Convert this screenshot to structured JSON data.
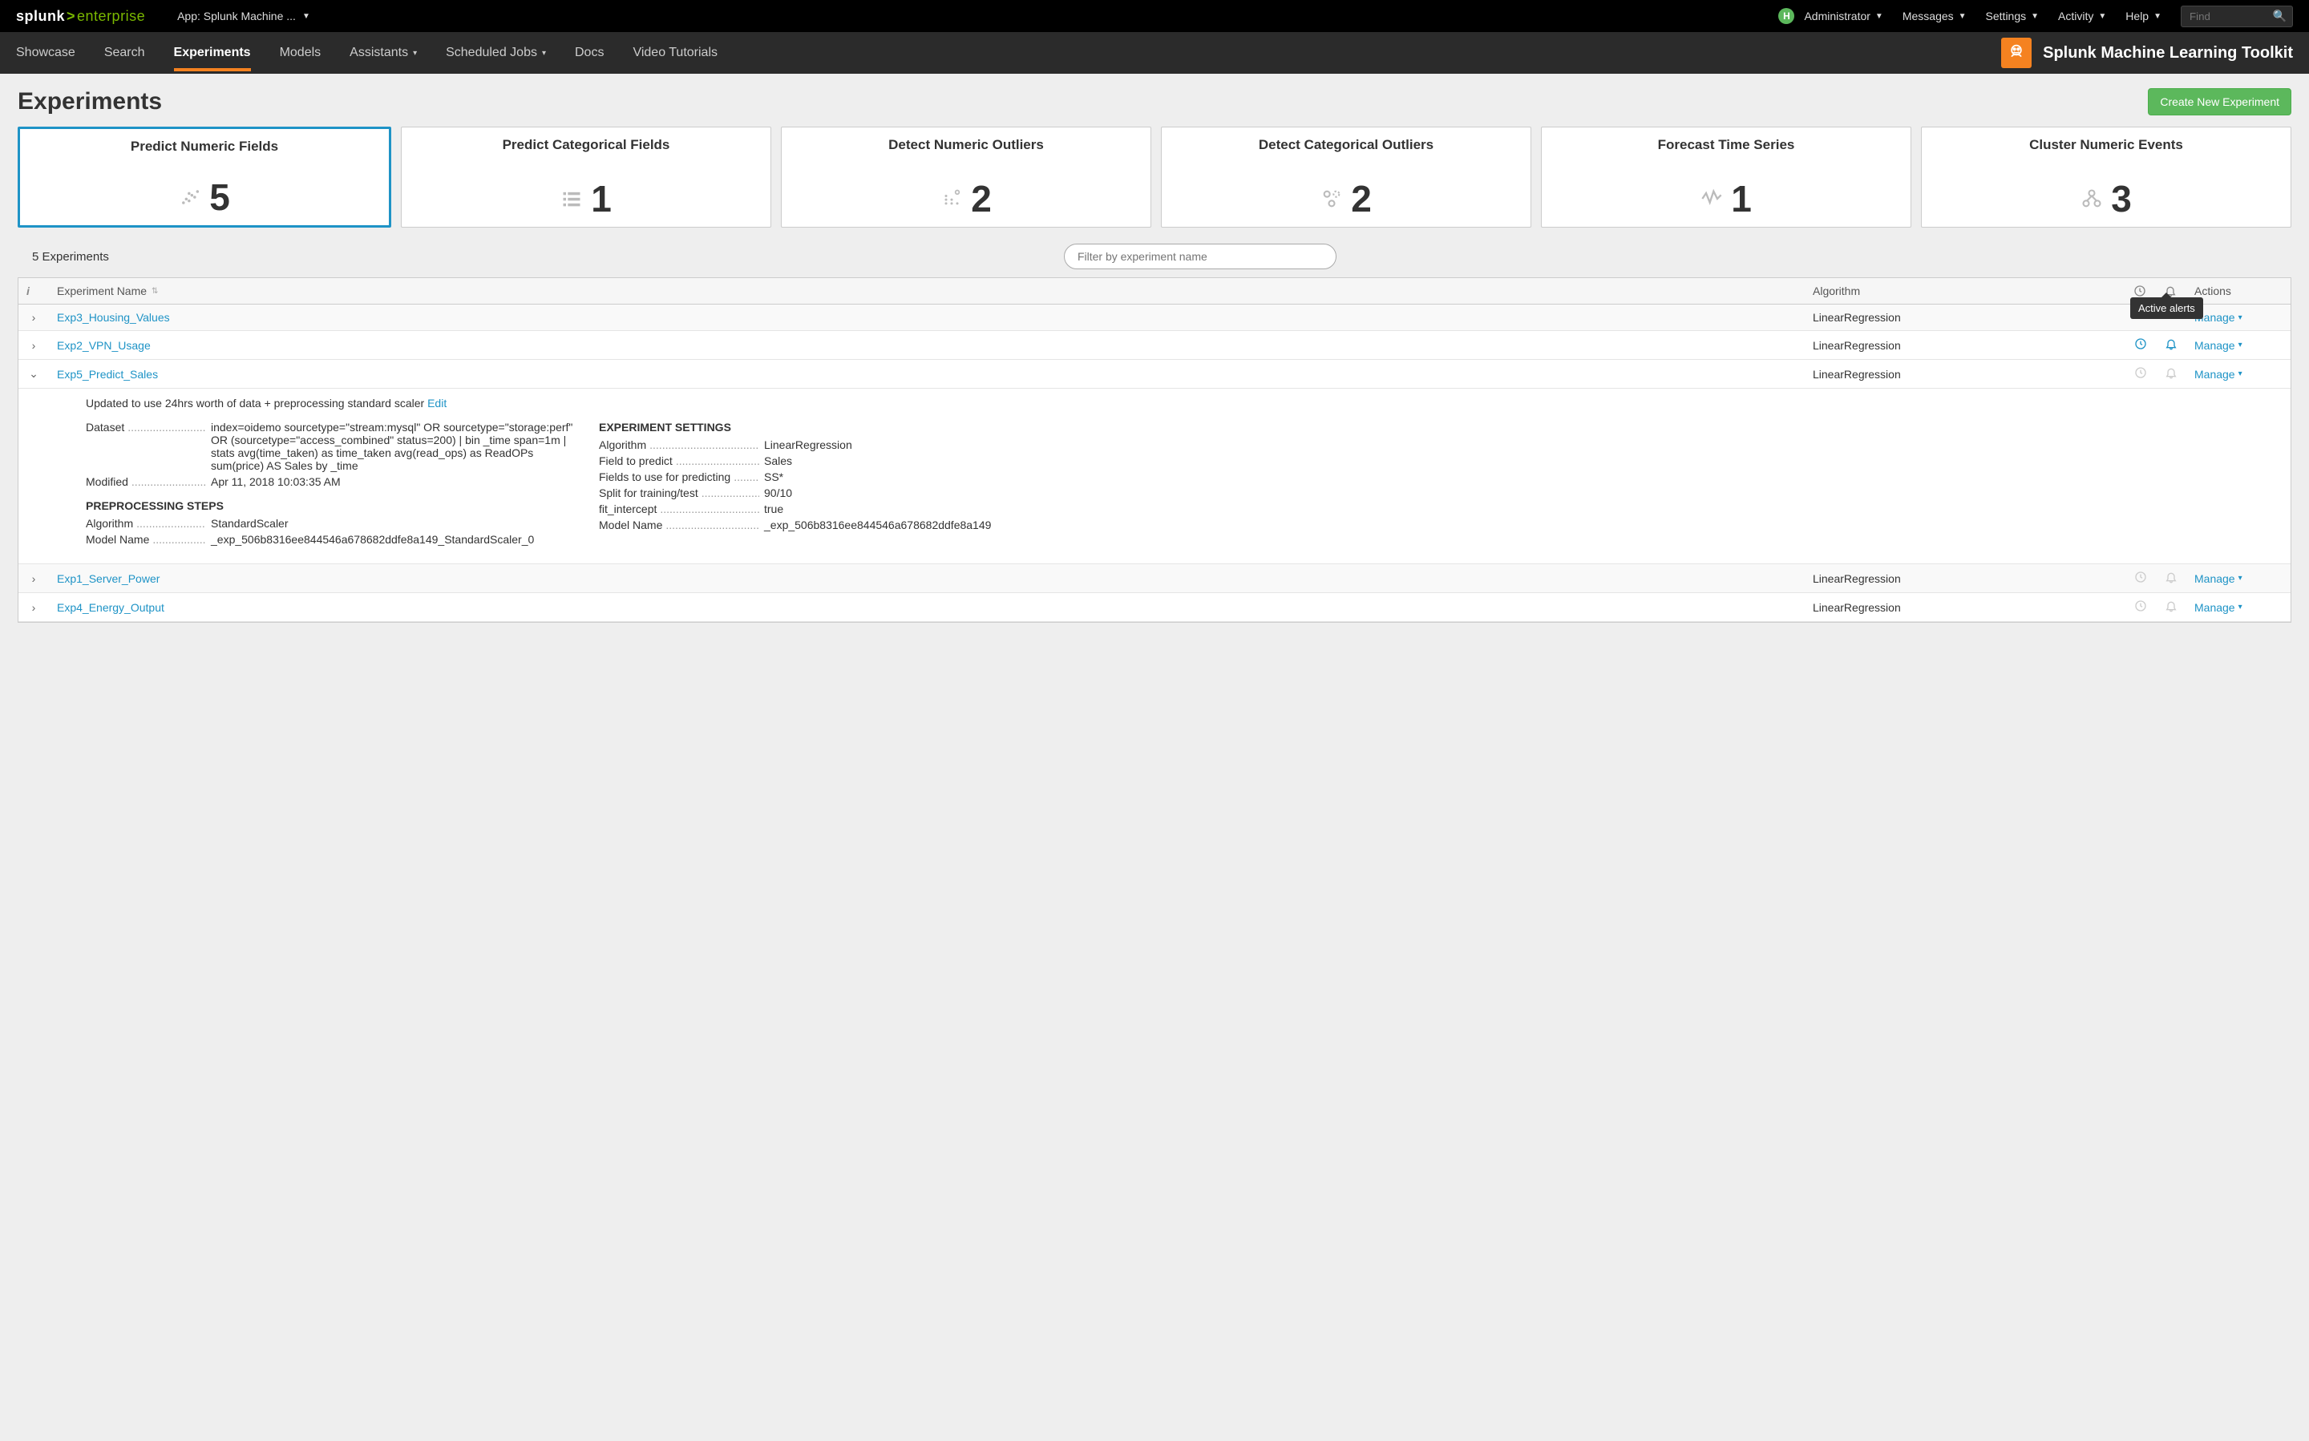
{
  "topbar": {
    "logo_prefix": "splunk",
    "logo_suffix": "enterprise",
    "app_selector": "App: Splunk Machine ...",
    "avatar_letter": "H",
    "items": [
      "Administrator",
      "Messages",
      "Settings",
      "Activity",
      "Help"
    ],
    "find_placeholder": "Find"
  },
  "nav": {
    "items": [
      {
        "label": "Showcase",
        "active": false,
        "dropdown": false
      },
      {
        "label": "Search",
        "active": false,
        "dropdown": false
      },
      {
        "label": "Experiments",
        "active": true,
        "dropdown": false
      },
      {
        "label": "Models",
        "active": false,
        "dropdown": false
      },
      {
        "label": "Assistants",
        "active": false,
        "dropdown": true
      },
      {
        "label": "Scheduled Jobs",
        "active": false,
        "dropdown": true
      },
      {
        "label": "Docs",
        "active": false,
        "dropdown": false
      },
      {
        "label": "Video Tutorials",
        "active": false,
        "dropdown": false
      }
    ],
    "app_title": "Splunk Machine Learning Toolkit"
  },
  "page": {
    "title": "Experiments",
    "create_btn": "Create New Experiment",
    "cards": [
      {
        "title": "Predict Numeric Fields",
        "count": "5",
        "selected": true
      },
      {
        "title": "Predict Categorical Fields",
        "count": "1",
        "selected": false
      },
      {
        "title": "Detect Numeric Outliers",
        "count": "2",
        "selected": false
      },
      {
        "title": "Detect Categorical Outliers",
        "count": "2",
        "selected": false
      },
      {
        "title": "Forecast Time Series",
        "count": "1",
        "selected": false
      },
      {
        "title": "Cluster Numeric Events",
        "count": "3",
        "selected": false
      }
    ],
    "experiments_count_label": "5 Experiments",
    "filter_placeholder": "Filter by experiment name",
    "tooltip_active_alerts": "Active alerts"
  },
  "table": {
    "headers": {
      "name": "Experiment Name",
      "algo": "Algorithm",
      "actions": "Actions"
    },
    "rows": [
      {
        "name": "Exp3_Housing_Values",
        "algo": "LinearRegression",
        "sched": false,
        "alert": false,
        "expanded": false,
        "manage": "Manage"
      },
      {
        "name": "Exp2_VPN_Usage",
        "algo": "LinearRegression",
        "sched": true,
        "alert": true,
        "expanded": false,
        "manage": "Manage"
      },
      {
        "name": "Exp5_Predict_Sales",
        "algo": "LinearRegression",
        "sched": false,
        "alert": false,
        "expanded": true,
        "manage": "Manage"
      },
      {
        "name": "Exp1_Server_Power",
        "algo": "LinearRegression",
        "sched": false,
        "alert": false,
        "expanded": false,
        "manage": "Manage"
      },
      {
        "name": "Exp4_Energy_Output",
        "algo": "LinearRegression",
        "sched": false,
        "alert": false,
        "expanded": false,
        "manage": "Manage"
      }
    ]
  },
  "details": {
    "description": "Updated to use 24hrs worth of data + preprocessing standard scaler",
    "edit_label": "Edit",
    "dataset_label": "Dataset",
    "dataset_value": "index=oidemo sourcetype=\"stream:mysql\" OR sourcetype=\"storage:perf\" OR (sourcetype=\"access_combined\" status=200) | bin _time span=1m | stats avg(time_taken) as time_taken avg(read_ops) as ReadOPs sum(price) AS Sales by _time",
    "modified_label": "Modified",
    "modified_value": "Apr 11, 2018 10:03:35 AM",
    "preproc_hdr": "PREPROCESSING STEPS",
    "preproc_algo_label": "Algorithm",
    "preproc_algo_value": "StandardScaler",
    "preproc_model_label": "Model Name",
    "preproc_model_value": "_exp_506b8316ee844546a678682ddfe8a149_StandardScaler_0",
    "settings_hdr": "EXPERIMENT SETTINGS",
    "settings": [
      {
        "label": "Algorithm",
        "value": "LinearRegression"
      },
      {
        "label": "Field to predict",
        "value": "Sales"
      },
      {
        "label": "Fields to use for predicting",
        "value": "SS*"
      },
      {
        "label": "Split for training/test",
        "value": "90/10"
      },
      {
        "label": "fit_intercept",
        "value": "true"
      },
      {
        "label": "Model Name",
        "value": "_exp_506b8316ee844546a678682ddfe8a149"
      }
    ]
  }
}
